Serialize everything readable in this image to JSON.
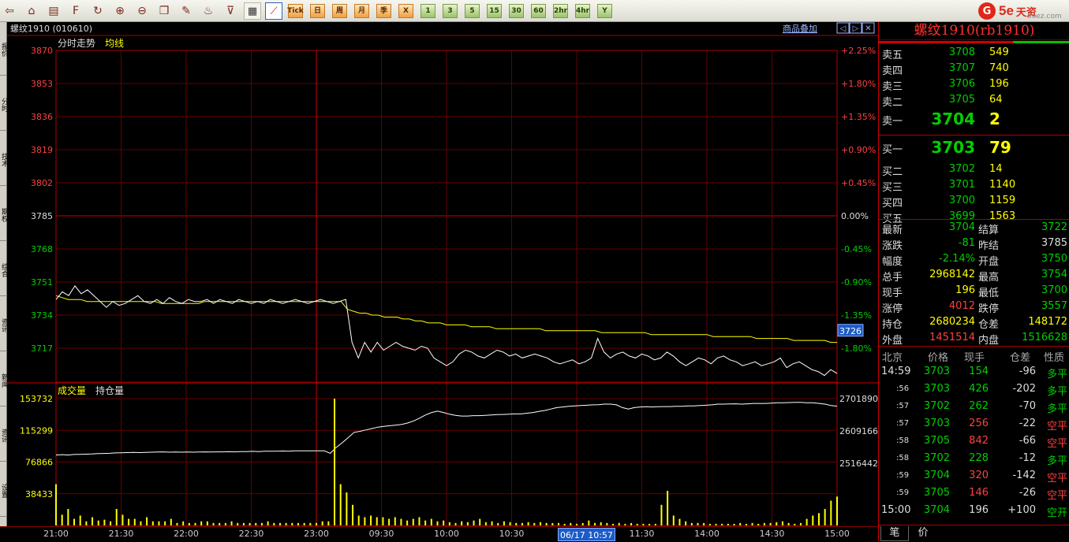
{
  "toolbar": {
    "tools": [
      {
        "name": "back-icon",
        "glyph": "⇦"
      },
      {
        "name": "home-icon",
        "glyph": "⌂"
      },
      {
        "name": "book-icon",
        "glyph": "▤"
      },
      {
        "name": "f10-icon",
        "glyph": "F"
      },
      {
        "name": "refresh-icon",
        "glyph": "↻"
      },
      {
        "name": "zoom-in-icon",
        "glyph": "⊕"
      },
      {
        "name": "zoom-out-icon",
        "glyph": "⊖"
      },
      {
        "name": "window-icon",
        "glyph": "❐"
      },
      {
        "name": "pen-icon",
        "glyph": "✎"
      },
      {
        "name": "paint-icon",
        "glyph": "♨"
      },
      {
        "name": "filter-icon",
        "glyph": "⊽"
      }
    ],
    "views": [
      {
        "name": "table-view-icon",
        "glyph": "▦",
        "active": false
      },
      {
        "name": "intraday-view-icon",
        "glyph": "⟋",
        "active": true
      }
    ],
    "periods": [
      {
        "label": "Tick",
        "style": "orange"
      },
      {
        "label": "日",
        "style": "orange"
      },
      {
        "label": "周",
        "style": "orange"
      },
      {
        "label": "月",
        "style": "orange"
      },
      {
        "label": "季",
        "style": "orange"
      },
      {
        "label": "X",
        "style": "orange"
      },
      {
        "label": "1",
        "style": "green"
      },
      {
        "label": "3",
        "style": "green"
      },
      {
        "label": "5",
        "style": "green"
      },
      {
        "label": "15",
        "style": "green"
      },
      {
        "label": "30",
        "style": "green"
      },
      {
        "label": "60",
        "style": "green"
      },
      {
        "label": "2hr",
        "style": "green"
      },
      {
        "label": "4hr",
        "style": "green"
      },
      {
        "label": "Y",
        "style": "green"
      }
    ],
    "logo": {
      "mark": "G",
      "brand": "5e",
      "brand2": "天资",
      "site": "5eez.com"
    }
  },
  "sidetabs": [
    "报价",
    "分时",
    "技术",
    "期权",
    "综合",
    "资讯",
    "新闻",
    "资讯",
    "设置"
  ],
  "chart_header": {
    "instrument": "螺纹1910 (010610)",
    "overlay_link": "商品叠加",
    "price_label": "分时走势",
    "avg_label": "均线",
    "vol_label": "成交量",
    "oi_label": "持仓量",
    "cursor_price": "3726",
    "cursor_time": "06/17 10:57"
  },
  "chart_data": {
    "type": "line",
    "title": "分时走势",
    "price_axis": {
      "ticks": [
        3870,
        3853,
        3836,
        3819,
        3802,
        3785,
        3768,
        3751,
        3734,
        3717
      ],
      "ylim": [
        3700,
        3870
      ],
      "prev_settle": 3785
    },
    "pct_axis": {
      "ticks": [
        "+2.25%",
        "+1.80%",
        "+1.35%",
        "+0.90%",
        "+0.45%",
        "0.00%",
        "-0.45%",
        "-0.90%",
        "-1.35%",
        "-1.80%"
      ]
    },
    "x_ticks": [
      "21:00",
      "21:30",
      "22:00",
      "22:30",
      "23:00",
      "09:30",
      "10:00",
      "10:30",
      "11:00",
      "11:30",
      "14:00",
      "14:30",
      "15:00"
    ],
    "series": [
      {
        "name": "price",
        "color": "#ffffff",
        "values": [
          3742,
          3746,
          3744,
          3749,
          3745,
          3747,
          3744,
          3741,
          3738,
          3741,
          3739,
          3740,
          3742,
          3744,
          3741,
          3740,
          3742,
          3740,
          3743,
          3741,
          3740,
          3742,
          3741,
          3741,
          3742,
          3740,
          3742,
          3741,
          3740,
          3742,
          3741,
          3740,
          3741,
          3740,
          3742,
          3741,
          3740,
          3741,
          3742,
          3741,
          3740,
          3741,
          3742,
          3741,
          3740,
          3741,
          3742,
          3720,
          3712,
          3720,
          3715,
          3720,
          3716,
          3718,
          3720,
          3718,
          3717,
          3716,
          3718,
          3717,
          3712,
          3710,
          3708,
          3710,
          3714,
          3716,
          3715,
          3713,
          3712,
          3714,
          3716,
          3715,
          3713,
          3714,
          3712,
          3713,
          3714,
          3713,
          3712,
          3710,
          3709,
          3710,
          3711,
          3709,
          3710,
          3712,
          3722,
          3715,
          3712,
          3714,
          3715,
          3713,
          3712,
          3714,
          3713,
          3711,
          3712,
          3715,
          3713,
          3710,
          3708,
          3710,
          3712,
          3711,
          3709,
          3712,
          3713,
          3711,
          3710,
          3708,
          3709,
          3710,
          3708,
          3709,
          3710,
          3712,
          3707,
          3709,
          3710,
          3708,
          3706,
          3705,
          3703,
          3706,
          3704
        ]
      },
      {
        "name": "avg",
        "color": "#ffff00",
        "values": [
          3744,
          3743,
          3742,
          3742,
          3742,
          3741,
          3741,
          3741,
          3741,
          3741,
          3741,
          3741,
          3741,
          3741,
          3741,
          3741,
          3741,
          3740,
          3740,
          3740,
          3740,
          3740,
          3740,
          3740,
          3741,
          3741,
          3741,
          3741,
          3741,
          3741,
          3741,
          3741,
          3741,
          3741,
          3741,
          3741,
          3741,
          3741,
          3741,
          3741,
          3741,
          3741,
          3741,
          3741,
          3741,
          3741,
          3741,
          3737,
          3736,
          3735,
          3735,
          3734,
          3734,
          3733,
          3733,
          3733,
          3732,
          3732,
          3731,
          3731,
          3730,
          3730,
          3730,
          3729,
          3729,
          3729,
          3729,
          3728,
          3728,
          3728,
          3728,
          3727,
          3727,
          3727,
          3727,
          3727,
          3727,
          3727,
          3727,
          3726,
          3726,
          3726,
          3726,
          3726,
          3726,
          3726,
          3726,
          3726,
          3725,
          3725,
          3725,
          3725,
          3725,
          3725,
          3725,
          3725,
          3724,
          3724,
          3724,
          3724,
          3724,
          3724,
          3724,
          3724,
          3724,
          3724,
          3723,
          3723,
          3723,
          3723,
          3723,
          3723,
          3723,
          3722,
          3722,
          3722,
          3722,
          3722,
          3722,
          3721,
          3721,
          3721,
          3721,
          3721,
          3721,
          3720,
          3720
        ]
      },
      {
        "name": "持仓量",
        "color": "#ffffff",
        "values": [
          2540000,
          2541000,
          2540000,
          2541500,
          2542000,
          2542500,
          2543000,
          2544000,
          2544500,
          2545000,
          2546000,
          2546500,
          2547000,
          2547500,
          2547000,
          2547500,
          2548000,
          2548500,
          2549000,
          2548000,
          2548500,
          2548000,
          2548500,
          2548000,
          2548500,
          2549000,
          2548500,
          2549000,
          2549000,
          2549500,
          2549000,
          2550000,
          2550000,
          2550500,
          2550000,
          2551000,
          2551000,
          2551000,
          2551500,
          2551000,
          2552000,
          2552000,
          2552000,
          2552000,
          2552000,
          2552000,
          2545000,
          2562000,
          2575000,
          2590000,
          2605000,
          2608000,
          2612000,
          2616000,
          2620000,
          2622000,
          2624000,
          2626000,
          2628000,
          2632000,
          2638000,
          2646000,
          2655000,
          2662000,
          2666000,
          2662000,
          2657000,
          2654000,
          2652000,
          2652000,
          2653000,
          2653000,
          2654000,
          2655000,
          2656000,
          2656500,
          2657000,
          2658000,
          2658000,
          2660000,
          2662000,
          2665000,
          2668000,
          2672000,
          2676000,
          2678000,
          2680000,
          2681000,
          2682000,
          2683000,
          2684000,
          2684500,
          2686000,
          2686000,
          2684000,
          2676000,
          2672000,
          2676000,
          2678000,
          2678500,
          2678000,
          2678500,
          2679000,
          2679000,
          2680000,
          2680000,
          2681000,
          2681000,
          2682000,
          2683000,
          2684000,
          2686000,
          2686000,
          2686500,
          2687000,
          2686000,
          2687000,
          2688000,
          2688000,
          2688000,
          2689000,
          2690000,
          2690000,
          2690500,
          2691000,
          2691000,
          2690000,
          2690000,
          2688000,
          2686000,
          2682000,
          2680234
        ]
      },
      {
        "name": "成交量",
        "color": "#ffff00",
        "values": [
          50000,
          13000,
          20000,
          8000,
          12000,
          5000,
          10000,
          6000,
          7000,
          5000,
          20000,
          13000,
          8000,
          8000,
          5000,
          10000,
          5000,
          5000,
          5000,
          8000,
          3000,
          5000,
          3000,
          3000,
          5000,
          5000,
          3000,
          3000,
          3000,
          5000,
          3000,
          3000,
          3000,
          3000,
          3000,
          5000,
          3000,
          3000,
          3000,
          3000,
          3000,
          3000,
          3000,
          3000,
          5000,
          5000,
          153732,
          50000,
          40000,
          25000,
          12000,
          10000,
          12000,
          10000,
          10000,
          8000,
          10000,
          8000,
          6000,
          8000,
          10000,
          6000,
          8000,
          5000,
          6000,
          4000,
          3000,
          5000,
          4000,
          6000,
          8000,
          4000,
          5000,
          3000,
          5000,
          4000,
          3000,
          3000,
          4000,
          3000,
          4000,
          3000,
          3000,
          3000,
          2000,
          3000,
          2000,
          3000,
          6000,
          3000,
          4000,
          3000,
          2000,
          3000,
          2000,
          3000,
          2000,
          2000,
          2000,
          2000,
          25000,
          42000,
          12000,
          8000,
          5000,
          3000,
          3000,
          3000,
          2000,
          2000,
          2000,
          2000,
          2000,
          3000,
          2000,
          3000,
          2000,
          3000,
          3000,
          4000,
          5000,
          3000,
          2000,
          3000,
          8000,
          12000,
          15000,
          20000,
          30000,
          35000
        ]
      }
    ],
    "volume_axis": {
      "ticks": [
        153732,
        115299,
        76866,
        38433
      ]
    },
    "oi_axis": {
      "ticks": [
        2701890,
        2609166,
        2516442
      ]
    }
  },
  "quote_panel": {
    "title": "螺纹1910(rb1910)",
    "asks": [
      {
        "label": "卖五",
        "price": "3708",
        "vol": "549"
      },
      {
        "label": "卖四",
        "price": "3707",
        "vol": "740"
      },
      {
        "label": "卖三",
        "price": "3706",
        "vol": "196"
      },
      {
        "label": "卖二",
        "price": "3705",
        "vol": "64"
      },
      {
        "label": "卖一",
        "price": "3704",
        "vol": "2"
      }
    ],
    "bids": [
      {
        "label": "买一",
        "price": "3703",
        "vol": "79"
      },
      {
        "label": "买二",
        "price": "3702",
        "vol": "14"
      },
      {
        "label": "买三",
        "price": "3701",
        "vol": "1140"
      },
      {
        "label": "买四",
        "price": "3700",
        "vol": "1159"
      },
      {
        "label": "买五",
        "price": "3699",
        "vol": "1563"
      }
    ],
    "stats": [
      {
        "k1": "最新",
        "v1": "3704",
        "c1": "g",
        "k2": "结算",
        "v2": "3722",
        "c2": "g"
      },
      {
        "k1": "涨跌",
        "v1": "-81",
        "c1": "g",
        "k2": "昨结",
        "v2": "3785",
        "c2": "w"
      },
      {
        "k1": "幅度",
        "v1": "-2.14%",
        "c1": "g",
        "k2": "开盘",
        "v2": "3750",
        "c2": "g"
      },
      {
        "k1": "总手",
        "v1": "2968142",
        "c1": "y",
        "k2": "最高",
        "v2": "3754",
        "c2": "g"
      },
      {
        "k1": "现手",
        "v1": "196",
        "c1": "y",
        "k2": "最低",
        "v2": "3700",
        "c2": "g"
      },
      {
        "k1": "涨停",
        "v1": "4012",
        "c1": "r",
        "k2": "跌停",
        "v2": "3557",
        "c2": "g"
      },
      {
        "k1": "持仓",
        "v1": "2680234",
        "c1": "y",
        "k2": "仓差",
        "v2": "148172",
        "c2": "y"
      },
      {
        "k1": "外盘",
        "v1": "1451514",
        "c1": "r",
        "k2": "内盘",
        "v2": "1516628",
        "c2": "g"
      }
    ],
    "tick_header": {
      "time": "北京",
      "price": "价格",
      "qty": "现手",
      "delta": "仓差",
      "nature": "性质"
    },
    "ticks": [
      {
        "time": "14:59",
        "small": false,
        "price": "3703",
        "qty": "154",
        "qc": "g",
        "delta": "-96",
        "dc": "w",
        "nature": "多平",
        "nc": "g"
      },
      {
        "time": ":56",
        "small": true,
        "price": "3703",
        "qty": "426",
        "qc": "g",
        "delta": "-202",
        "dc": "w",
        "nature": "多平",
        "nc": "g"
      },
      {
        "time": ":57",
        "small": true,
        "price": "3702",
        "qty": "262",
        "qc": "g",
        "delta": "-70",
        "dc": "w",
        "nature": "多平",
        "nc": "g"
      },
      {
        "time": ":57",
        "small": true,
        "price": "3703",
        "qty": "256",
        "qc": "r",
        "delta": "-22",
        "dc": "w",
        "nature": "空平",
        "nc": "r"
      },
      {
        "time": ":58",
        "small": true,
        "price": "3705",
        "qty": "842",
        "qc": "r",
        "delta": "-66",
        "dc": "w",
        "nature": "空平",
        "nc": "r"
      },
      {
        "time": ":58",
        "small": true,
        "price": "3702",
        "qty": "228",
        "qc": "g",
        "delta": "-12",
        "dc": "w",
        "nature": "多平",
        "nc": "g"
      },
      {
        "time": ":59",
        "small": true,
        "price": "3704",
        "qty": "320",
        "qc": "r",
        "delta": "-142",
        "dc": "w",
        "nature": "空平",
        "nc": "r"
      },
      {
        "time": ":59",
        "small": true,
        "price": "3705",
        "qty": "146",
        "qc": "r",
        "delta": "-26",
        "dc": "w",
        "nature": "空平",
        "nc": "r"
      },
      {
        "time": "15:00",
        "small": false,
        "price": "3704",
        "qty": "196",
        "qc": "w",
        "delta": "+100",
        "dc": "w",
        "nature": "空开",
        "nc": "g"
      }
    ],
    "tabs": [
      "笔",
      "价"
    ]
  }
}
